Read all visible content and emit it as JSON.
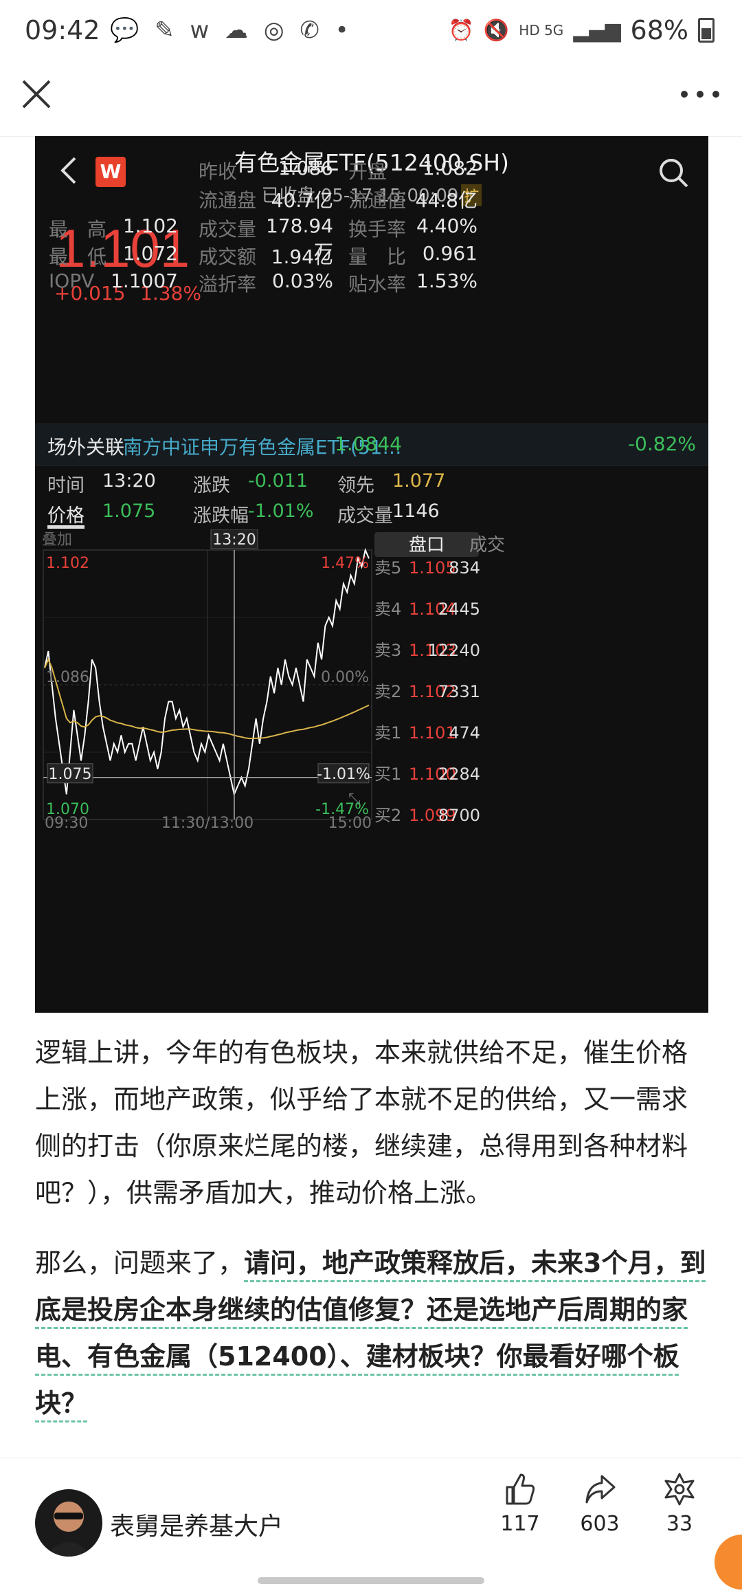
{
  "status_bar": {
    "time": "09:42",
    "left_icons": "💬 ✎ w ☁ ◎ ✆ •",
    "network": "HD 5G",
    "battery": "68%"
  },
  "stock": {
    "title": "有色金属ETF(512400.SH)",
    "status": "已收盘 05-17 15:00:09",
    "status_badge": "扩",
    "logo": "W",
    "price": "1.101",
    "change": "+0.015",
    "change_pct": "1.38%",
    "quote_rows": [
      [
        {
          "l": "昨收",
          "v": "1.086"
        },
        {
          "l": "开盘",
          "v": "1.082"
        }
      ],
      [
        {
          "l": "流通盘",
          "v": "40.7亿"
        },
        {
          "l": "流通值",
          "v": "44.8亿"
        }
      ],
      [
        {
          "l": "成交量",
          "v": "178.94万"
        },
        {
          "l": "换手率",
          "v": "4.40%"
        }
      ],
      [
        {
          "l": "成交额",
          "v": "1.94亿"
        },
        {
          "l": "量　比",
          "v": "0.961"
        }
      ],
      [
        {
          "l": "溢折率",
          "v": "0.03%"
        },
        {
          "l": "贴水率",
          "v": "1.53%"
        }
      ]
    ],
    "left_rows": [
      {
        "l": "最　高",
        "v": "1.102"
      },
      {
        "l": "最　低",
        "v": "1.072"
      },
      {
        "l": "IOPV",
        "v": "1.1007"
      }
    ],
    "otc": {
      "label": "场外关联",
      "name": "南方中证申万有色金属ETF(51…",
      "value": "1.0844",
      "pct": "-0.82%"
    },
    "info": {
      "time_label": "时间",
      "time": "13:20",
      "price_label": "价格",
      "price": "1.075",
      "chg_label": "涨跌",
      "chg": "-0.011",
      "chg_pct_label": "涨跌幅",
      "chg_pct": "-1.01%",
      "lead_label": "领先",
      "lead": "1.077",
      "vol_label": "成交量",
      "vol": "1146"
    },
    "overlay_label": "叠加",
    "tabs": [
      "盘口",
      "成交"
    ],
    "order_book": [
      {
        "label": "卖5",
        "price": "1.105",
        "qty": "834"
      },
      {
        "label": "卖4",
        "price": "1.104",
        "qty": "2445"
      },
      {
        "label": "卖3",
        "price": "1.103",
        "qty": "12240"
      },
      {
        "label": "卖2",
        "price": "1.102",
        "qty": "7331"
      },
      {
        "label": "卖1",
        "price": "1.101",
        "qty": "474"
      },
      {
        "label": "买1",
        "price": "1.100",
        "qty": "2284"
      },
      {
        "label": "买2",
        "price": "1.099",
        "qty": "8700"
      }
    ],
    "chart": {
      "y_top": "1.102",
      "y_mid": "1.086",
      "y_bot": "1.070",
      "pct_top": "1.47%",
      "pct_mid": "0.00%",
      "pct_bot": "-1.47%",
      "cursor_time": "13:20",
      "cursor_price": "1.075",
      "cursor_pct": "-1.01%",
      "x_labels": [
        "09:30",
        "11:30/13:00",
        "15:00"
      ],
      "colors": {
        "price_line": "#ffffff",
        "avg_line": "#d9b44a",
        "up": "#e8413a",
        "down": "#3bbf5a"
      }
    }
  },
  "article": {
    "para1": "逻辑上讲，今年的有色板块，本来就供给不足，催生价格上涨，而地产政策，似乎给了本就不足的供给，又一需求侧的打击（你原来烂尾的楼，继续建，总得用到各种材料吧？），供需矛盾加大，推动价格上涨。",
    "para2_lead": "那么，问题来了，",
    "para2_question": "请问，地产政策释放后，未来3个月，到底是投房企本身继续的估值修复？还是选地产后周期的家电、有色金属（512400）、建材板块？你最看好哪个板块？"
  },
  "footer": {
    "author": "表舅是养基大户",
    "likes": "117",
    "shares": "603",
    "gifts": "33"
  }
}
